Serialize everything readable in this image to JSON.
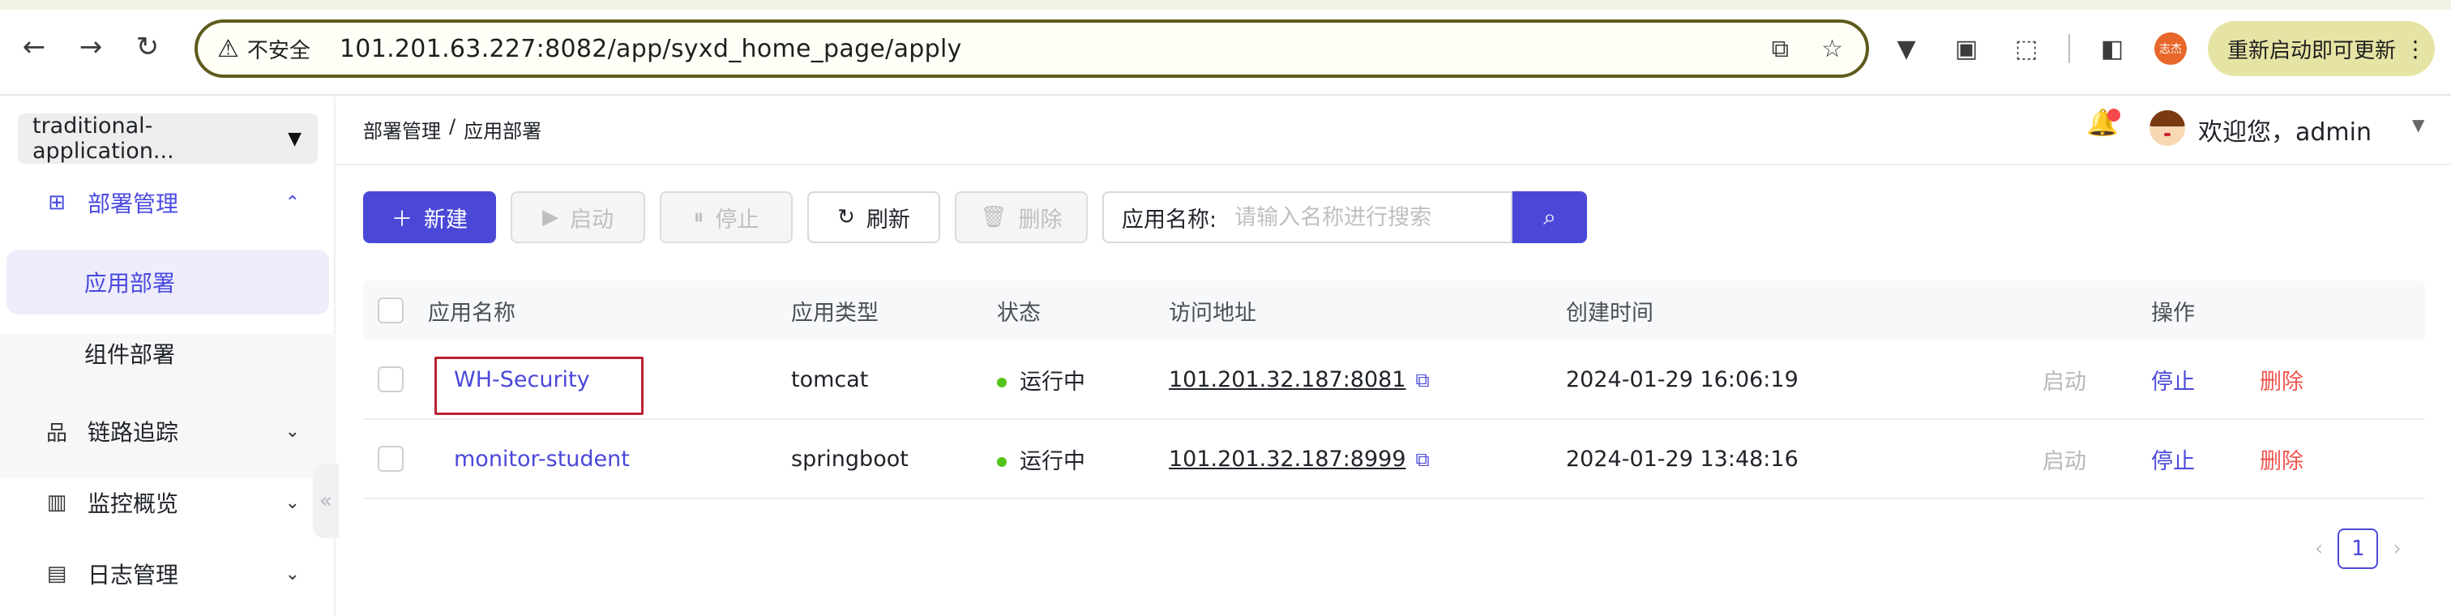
{
  "browser": {
    "security_label": "不安全",
    "url": "101.201.63.227:8082/app/syxd_home_page/apply",
    "update_label": "重新启动即可更新",
    "profile_initials": "志杰"
  },
  "sidebar": {
    "app_selector": "traditional-application...",
    "groups": [
      {
        "label": "部署管理",
        "icon": "grid-icon",
        "expanded": true,
        "children": [
          {
            "label": "应用部署",
            "active": true
          },
          {
            "label": "组件部署",
            "active": false
          }
        ]
      },
      {
        "label": "链路追踪",
        "icon": "topology-icon",
        "expanded": false
      },
      {
        "label": "监控概览",
        "icon": "bar-chart-icon",
        "expanded": false
      },
      {
        "label": "日志管理",
        "icon": "log-icon",
        "expanded": false
      }
    ]
  },
  "header": {
    "breadcrumb": [
      "部署管理",
      "/",
      "应用部署"
    ],
    "welcome": "欢迎您，admin"
  },
  "toolbar": {
    "new_label": "新建",
    "start_label": "启动",
    "stop_label": "停止",
    "refresh_label": "刷新",
    "delete_label": "删除",
    "search_label": "应用名称:",
    "search_placeholder": "请输入名称进行搜索"
  },
  "table": {
    "columns": [
      "应用名称",
      "应用类型",
      "状态",
      "访问地址",
      "创建时间",
      "操作"
    ],
    "rows": [
      {
        "name": "WH-Security",
        "type": "tomcat",
        "status": "运行中",
        "address": "101.201.32.187:8081",
        "created": "2024-01-29 16:06:19",
        "actions": [
          "启动",
          "停止",
          "删除"
        ]
      },
      {
        "name": "monitor-student",
        "type": "springboot",
        "status": "运行中",
        "address": "101.201.32.187:8999",
        "created": "2024-01-29 13:48:16",
        "actions": [
          "启动",
          "停止",
          "删除"
        ]
      }
    ]
  },
  "pagination": {
    "current": "1"
  },
  "colors": {
    "primary": "#4b48d8",
    "danger": "#f0534e",
    "success": "#52c41a"
  }
}
